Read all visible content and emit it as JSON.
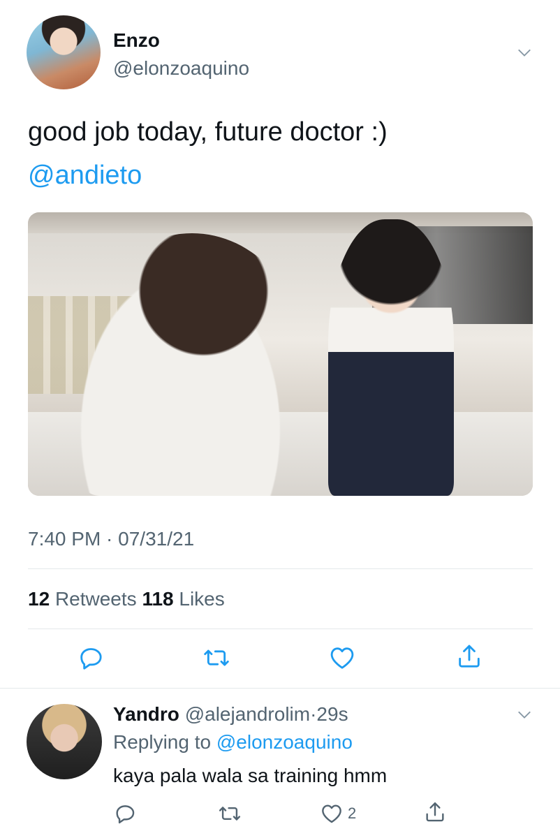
{
  "tweet": {
    "author_name": "Enzo",
    "author_handle": "@elonzoaquino",
    "text": "good job today, future doctor :)",
    "mention": "@andieto",
    "timestamp": "7:40 PM · 07/31/21",
    "retweets_count": "12",
    "retweets_label": "Retweets",
    "likes_count": "118",
    "likes_label": "Likes"
  },
  "reply": {
    "author_name": "Yandro",
    "author_handle": "@alejandrolim",
    "time_sep": "·",
    "time": "29s",
    "replying_prefix": "Replying to",
    "replying_to": "@elonzoaquino",
    "text": "kaya pala wala sa training hmm",
    "likes_count": "2"
  },
  "icons": [
    "chevron-down-icon",
    "reply-icon",
    "retweet-icon",
    "like-icon",
    "share-icon"
  ],
  "colors": {
    "accent": "#1d9bf0",
    "secondary_text": "#536471",
    "divider": "#e4e8eb"
  }
}
